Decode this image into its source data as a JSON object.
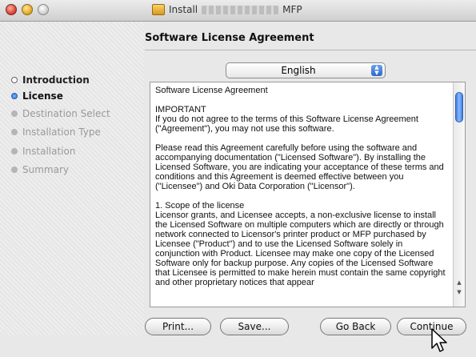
{
  "window": {
    "title_prefix": "Install",
    "title_suffix": "MFP"
  },
  "header": {
    "title": "Software License Agreement"
  },
  "sidebar": {
    "steps": [
      {
        "label": "Introduction",
        "state": "done"
      },
      {
        "label": "License",
        "state": "current"
      },
      {
        "label": "Destination Select",
        "state": "future"
      },
      {
        "label": "Installation Type",
        "state": "future"
      },
      {
        "label": "Installation",
        "state": "future"
      },
      {
        "label": "Summary",
        "state": "future"
      }
    ]
  },
  "language": {
    "selected": "English"
  },
  "license": {
    "paragraphs": [
      "Software License Agreement",
      "IMPORTANT\nIf you do not agree to the terms of this Software License Agreement (\"Agreement\"), you may not use this software.",
      "Please read this Agreement carefully before using the software and accompanying documentation (\"Licensed Software\"). By installing the Licensed Software, you are indicating your acceptance of these terms and conditions and this Agreement is deemed effective between you (\"Licensee\") and Oki Data Corporation (\"Licensor\").",
      "1. Scope of the license\nLicensor grants, and Licensee accepts, a non-exclusive license to install the Licensed Software on multiple computers which are directly or through network connected to Licensor's printer product or MFP purchased by Licensee (\"Product\") and to use the Licensed Software solely in conjunction with Product. Licensee may make one copy of the Licensed Software only for backup purpose. Any copies of the Licensed Software that Licensee is permitted to make herein must contain the same copyright and other proprietary notices that appear"
    ]
  },
  "buttons": {
    "print": "Print...",
    "save": "Save...",
    "go_back": "Go Back",
    "continue": "Continue"
  },
  "colors": {
    "accent": "#2f6fd0"
  }
}
